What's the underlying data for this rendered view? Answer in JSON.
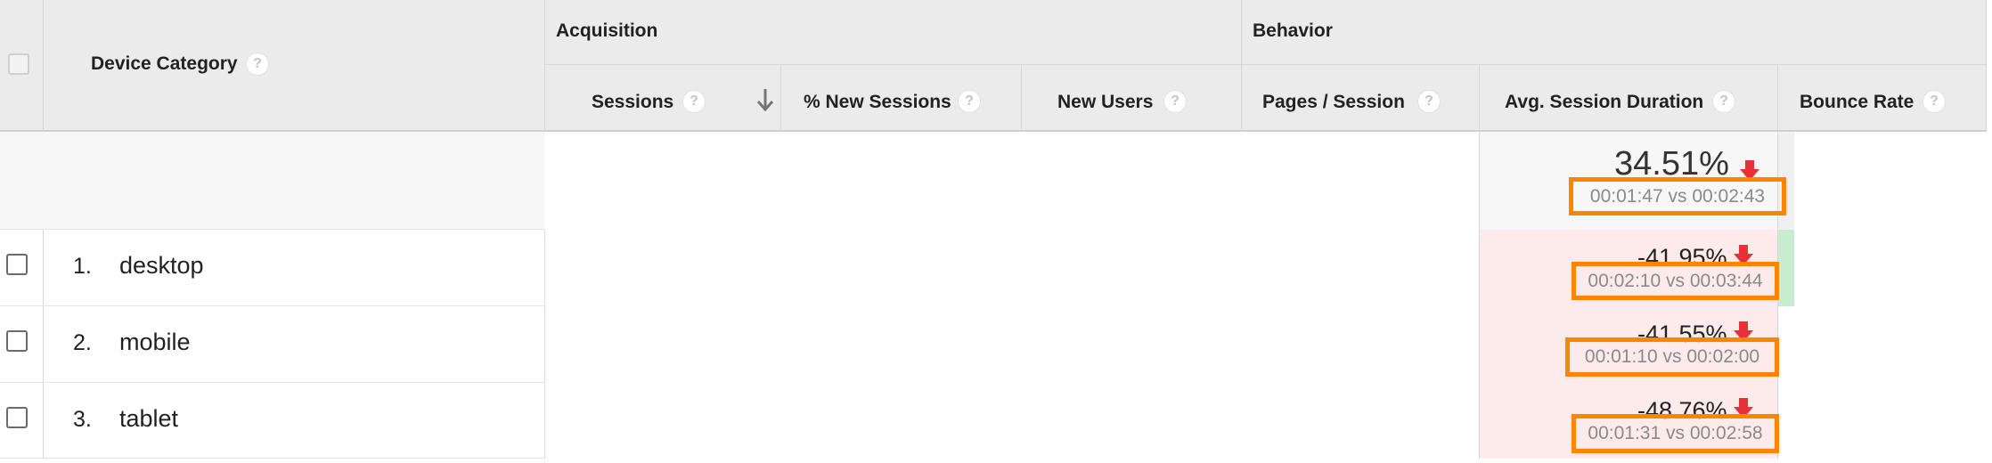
{
  "header": {
    "groups": {
      "acquisition": "Acquisition",
      "behavior": "Behavior"
    },
    "columns": {
      "device_category": "Device Category",
      "sessions": "Sessions",
      "pct_new_sessions": "% New Sessions",
      "new_users": "New Users",
      "pages_per_session": "Pages / Session",
      "avg_session_duration": "Avg. Session Duration",
      "bounce_rate": "Bounce Rate"
    },
    "help_glyph": "?",
    "sort_icon": "sort-descending-arrow"
  },
  "summary": {
    "avg_session_duration_change": "34.51%",
    "avg_session_duration_compare": "00:01:47 vs 00:02:43"
  },
  "rows": [
    {
      "num": "1.",
      "name": "desktop",
      "change": "-41.95%",
      "compare": "00:02:10 vs 00:03:44"
    },
    {
      "num": "2.",
      "name": "mobile",
      "change": "-41.55%",
      "compare": "00:01:10 vs 00:02:00"
    },
    {
      "num": "3.",
      "name": "tablet",
      "change": "-48.76%",
      "compare": "00:01:31 vs 00:02:58"
    }
  ],
  "colors": {
    "header_bg": "#ebebeb",
    "negative_cell_bg": "#fdeaea",
    "positive_cell_bg": "#c8ecd0",
    "highlight_border": "#ff8400",
    "down_arrow": "#e8303a"
  }
}
